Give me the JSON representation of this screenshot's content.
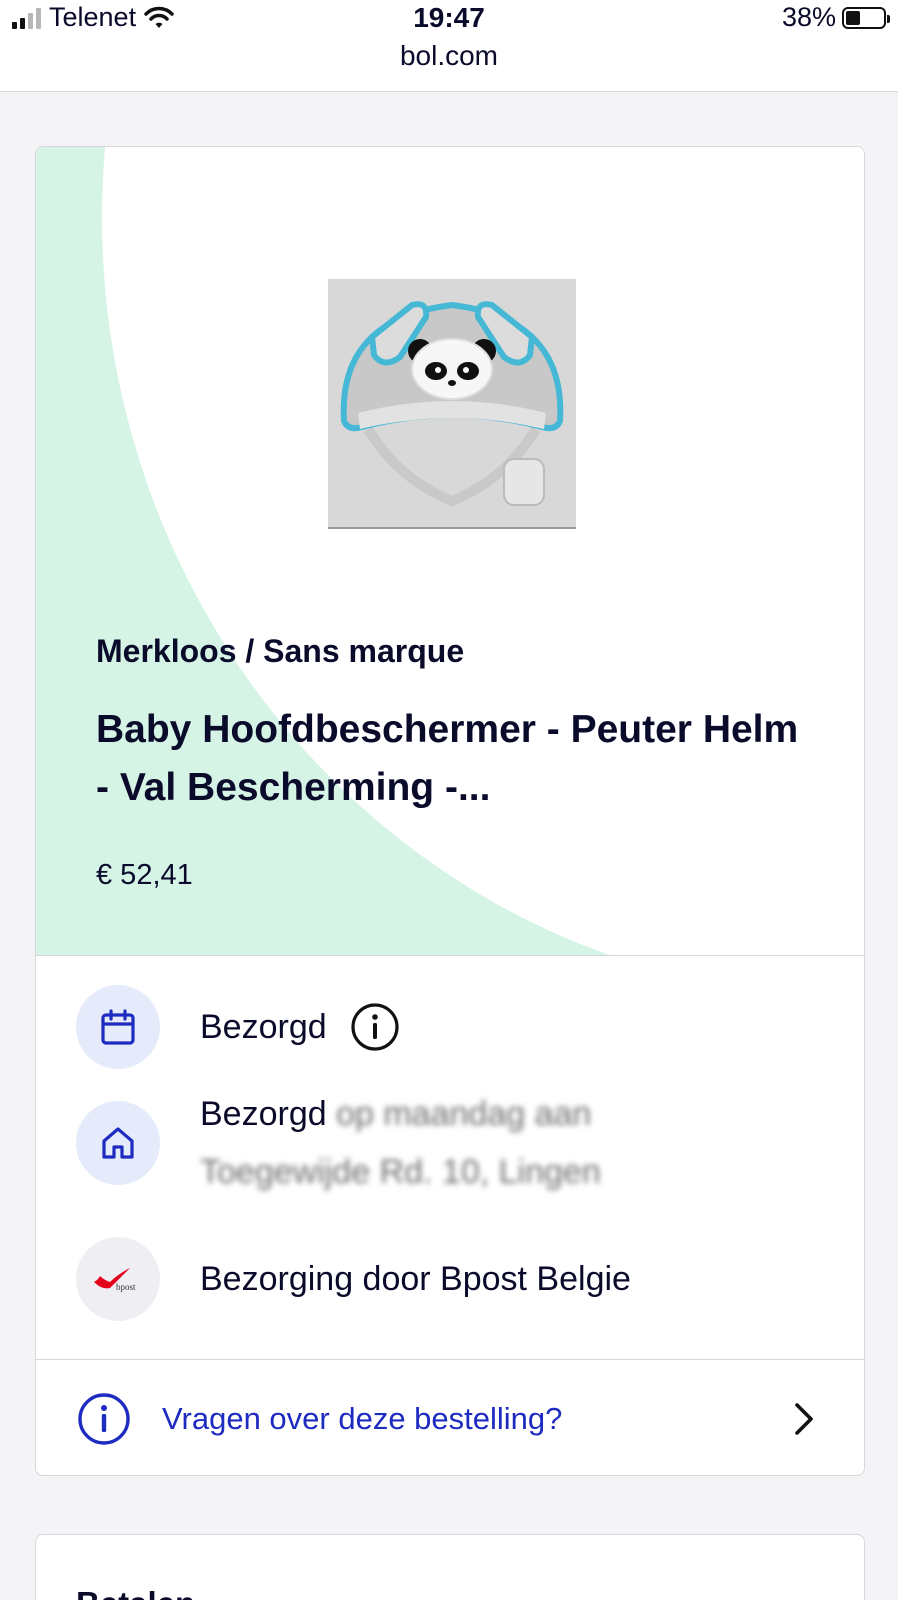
{
  "status_bar": {
    "carrier": "Telenet",
    "time": "19:47",
    "url": "bol.com",
    "battery": "38%",
    "battery_level": 0.38
  },
  "order": {
    "brand": "Merkloos / Sans marque",
    "title": "Baby Hoofdbeschermer - Peuter Helm - Val Bescherming -...",
    "price": "€ 52,41",
    "status": "Bezorgd",
    "delivery_prefix": "Bezorgd",
    "delivery_blurred_1": "op maandag aan",
    "delivery_blurred_2": "Toegewijde Rd. 10, Lingen",
    "carrier_text": "Bezorging door Bpost Belgie",
    "bpost_logo_text": "bpost"
  },
  "help": {
    "link_label": "Vragen over deze bestelling?"
  },
  "next_section": {
    "title": "Betalen"
  },
  "colors": {
    "hero_bg": "#d6f4e6",
    "link": "#1d2bc1",
    "icon_bg": "#e5ebfb",
    "bpost_red": "#e2001a"
  }
}
